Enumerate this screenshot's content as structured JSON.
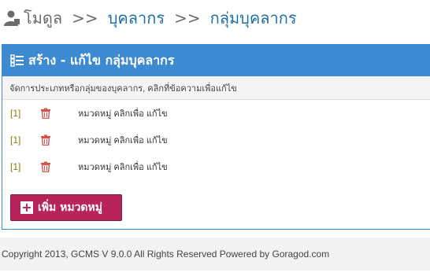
{
  "breadcrumb": {
    "items": [
      "โมดูล",
      "บุคลากร",
      "กลุ่มบุคลากร"
    ],
    "separator": ">>"
  },
  "panel": {
    "title": "สร้าง - แก้ไข กลุ่มบุคลากร",
    "description": "จัดการประเภทหรือกลุ่มของบุคลากร, คลิกที่ข้อความเพื่อแก้ไข",
    "rows": [
      {
        "id": "[1]",
        "label": "หมวดหมู่ คลิกเพื่อ แก้ไข",
        "icon": "trash-icon"
      },
      {
        "id": "[1]",
        "label": "หมวดหมู่ คลิกเพื่อ แก้ไข",
        "icon": "trash-icon"
      },
      {
        "id": "[1]",
        "label": "หมวดหมู่ คลิกเพื่อ แก้ไข",
        "icon": "trash-icon"
      }
    ],
    "add_button_label": "เพิ่ม หมวดหมู่"
  },
  "footer": {
    "text": "Copyright 2013, GCMS V 9.0.0 All Rights Reserved Powered by Goragod.com"
  },
  "colors": {
    "header_blue": "#3d8ad0",
    "link_blue": "#1f6fa8",
    "button_magenta": "#b8235c",
    "trash_red": "#d9534f",
    "id_olive": "#8a7a10"
  }
}
